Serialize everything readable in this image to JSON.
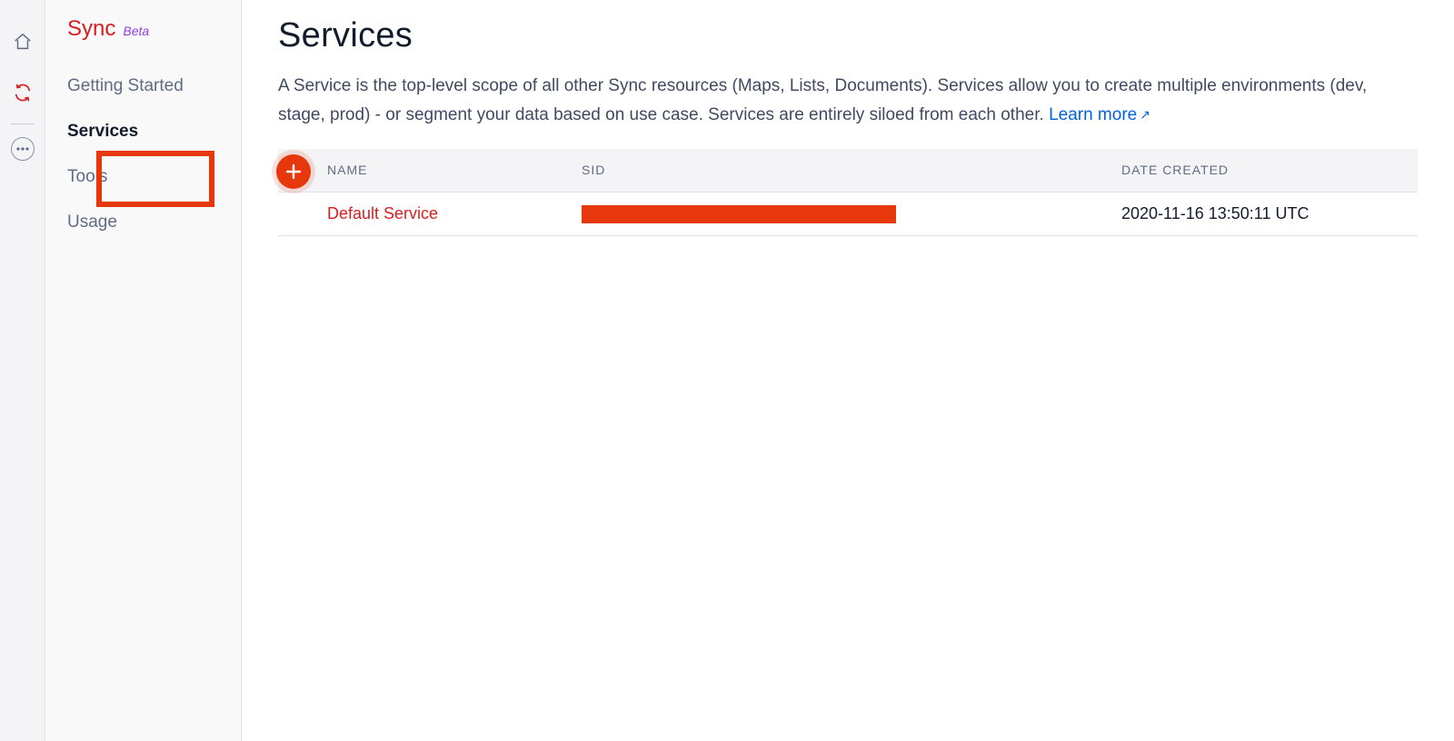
{
  "sidebar": {
    "title": "Sync",
    "badge": "Beta",
    "items": [
      {
        "label": "Getting Started"
      },
      {
        "label": "Services"
      },
      {
        "label": "Tools"
      },
      {
        "label": "Usage"
      }
    ],
    "active_index": 1,
    "highlighted_index": 2
  },
  "main": {
    "title": "Services",
    "description": "A Service is the top-level scope of all other Sync resources (Maps, Lists, Documents). Services allow you to create multiple environments (dev, stage, prod) - or segment your data based on use case. Services are entirely siloed from each other. ",
    "learn_more_label": "Learn more"
  },
  "table": {
    "headers": {
      "name": "NAME",
      "sid": "SID",
      "date": "DATE CREATED"
    },
    "rows": [
      {
        "name": "Default Service",
        "sid": "",
        "date": "2020-11-16 13:50:11 UTC"
      }
    ]
  }
}
